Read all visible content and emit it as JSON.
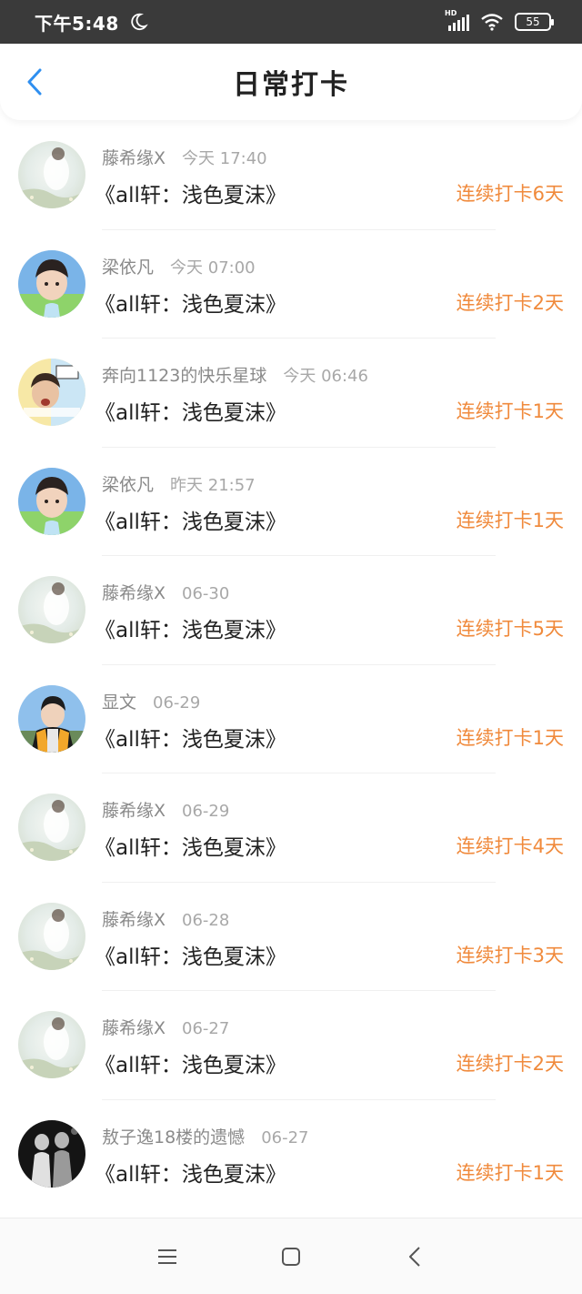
{
  "status": {
    "time": "下午5:48",
    "network": "HD",
    "battery": "55"
  },
  "header": {
    "title": "日常打卡"
  },
  "colors": {
    "accent": "#f08a3c",
    "back": "#2f8ff0"
  },
  "checkins": [
    {
      "user": "藤希缘X",
      "time": "今天 17:40",
      "book": "《all轩：浅色夏沫》",
      "streak": "连续打卡6天",
      "avatar": "avatar-flower"
    },
    {
      "user": "梁依凡",
      "time": "今天 07:00",
      "book": "《all轩：浅色夏沫》",
      "streak": "连续打卡2天",
      "avatar": "avatar-boy-blue"
    },
    {
      "user": "奔向1123的快乐星球",
      "time": "今天 06:46",
      "book": "《all轩：浅色夏沫》",
      "streak": "连续打卡1天",
      "avatar": "avatar-meme"
    },
    {
      "user": "梁依凡",
      "time": "昨天 21:57",
      "book": "《all轩：浅色夏沫》",
      "streak": "连续打卡1天",
      "avatar": "avatar-boy-blue"
    },
    {
      "user": "藤希缘X",
      "time": "06-30",
      "book": "《all轩：浅色夏沫》",
      "streak": "连续打卡5天",
      "avatar": "avatar-flower"
    },
    {
      "user": "显文",
      "time": "06-29",
      "book": "《all轩：浅色夏沫》",
      "streak": "连续打卡1天",
      "avatar": "avatar-jacket"
    },
    {
      "user": "藤希缘X",
      "time": "06-29",
      "book": "《all轩：浅色夏沫》",
      "streak": "连续打卡4天",
      "avatar": "avatar-flower"
    },
    {
      "user": "藤希缘X",
      "time": "06-28",
      "book": "《all轩：浅色夏沫》",
      "streak": "连续打卡3天",
      "avatar": "avatar-flower"
    },
    {
      "user": "藤希缘X",
      "time": "06-27",
      "book": "《all轩：浅色夏沫》",
      "streak": "连续打卡2天",
      "avatar": "avatar-flower"
    },
    {
      "user": "敖子逸18楼的遗憾",
      "time": "06-27",
      "book": "《all轩：浅色夏沫》",
      "streak": "连续打卡1天",
      "avatar": "avatar-dark"
    }
  ]
}
